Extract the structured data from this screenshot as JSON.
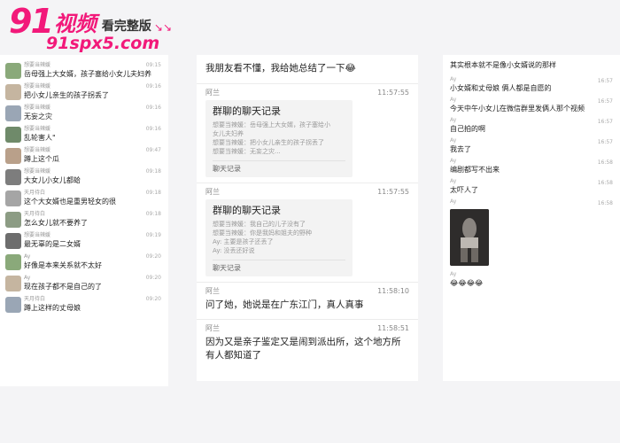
{
  "watermark": {
    "number": "91",
    "brand": "视频",
    "subtitle": "看完整版",
    "arrows": "↘↘",
    "url": "91spx5.com"
  },
  "left_panel": {
    "messages": [
      {
        "name": "想要当辣媛",
        "time": "09:15",
        "text": "岳母强上大女婿，孩子塞给小女儿夫妇养"
      },
      {
        "name": "想要当辣媛",
        "time": "09:16",
        "text": "把小女儿亲生的孩子拐丢了"
      },
      {
        "name": "想要当辣媛",
        "time": "09:16",
        "text": "无妄之灾"
      },
      {
        "name": "想要当辣媛",
        "time": "09:16",
        "text": "乱轮害人\""
      },
      {
        "name": "想要当辣媛",
        "time": "09:47",
        "text": "蹲上这个瓜"
      },
      {
        "name": "想要当辣媛",
        "time": "09:18",
        "text": "大女儿小女儿都蛤"
      },
      {
        "name": "天月待白",
        "time": "09:18",
        "text": "这个大女婿也是重男轻女的很"
      },
      {
        "name": "天月待白",
        "time": "09:18",
        "text": "怎么女儿就不要养了"
      },
      {
        "name": "想要当辣媛",
        "time": "09:19",
        "text": "最无辜的是二女婿"
      },
      {
        "name": "Ay",
        "time": "09:20",
        "text": "好像是本来关系就不太好"
      },
      {
        "name": "Ay",
        "time": "09:20",
        "text": "现在孩子都不是自己的了"
      },
      {
        "name": "天月待白",
        "time": "09:20",
        "text": "蹲上这样的丈母娘"
      }
    ]
  },
  "middle_panel": {
    "top_text": "我朋友看不懂，我给她总结了一下😂",
    "blocks": [
      {
        "sender": "阿兰",
        "time": "11:57:55",
        "card": {
          "title": "群聊的聊天记录",
          "lines": [
            "想要当辣媛：岳母强上大女婿，孩子塞给小",
            "女儿夫妇养",
            "想要当辣媛：把小女儿亲生的孩子拐丢了",
            "想要当辣媛：无妄之灾..."
          ],
          "footer": "聊天记录"
        }
      },
      {
        "sender": "阿兰",
        "time": "11:57:55",
        "card": {
          "title": "群聊的聊天记录",
          "lines": [
            "想要当辣媛：我自己的儿子没有了",
            "想要当辣媛：你是我妈和姐夫的野种",
            "Ay: 主要是孩子还丢了",
            "Ay: 没丢还好说"
          ],
          "footer": "聊天记录"
        }
      },
      {
        "sender": "阿兰",
        "time": "11:58:10",
        "text": "问了她，她说是在广东江门，真人真事"
      },
      {
        "sender": "阿兰",
        "time": "11:58:51",
        "text": "因为又是亲子鉴定又是闹到派出所，这个地方所有人都知道了"
      }
    ]
  },
  "right_panel": {
    "top_text": "其实根本就不是像小女婿说的那样",
    "messages": [
      {
        "name": "Ay",
        "time": "16:57",
        "text": "小女婿和丈母娘 俩人都是自愿的"
      },
      {
        "name": "Ay",
        "time": "16:57",
        "text": "今天中午小女儿在微信群里发俩人那个视频"
      },
      {
        "name": "Ay",
        "time": "16:57",
        "text": "自己拍的啊"
      },
      {
        "name": "Ay",
        "time": "16:57",
        "text": "我去了"
      },
      {
        "name": "Ay",
        "time": "16:58",
        "text": "编剧都写不出来"
      },
      {
        "name": "Ay",
        "time": "16:58",
        "text": "太吓人了"
      },
      {
        "name": "Ay",
        "time": "16:58",
        "text": ""
      },
      {
        "name": "Ay",
        "time": "",
        "text": "😂😂😂😂"
      }
    ]
  },
  "colors": {
    "brand": "#f2197a",
    "page_bg": "#f4f4f6"
  },
  "avatar_colors": [
    "#8aa97a",
    "#c5b5a0",
    "#9aa6b5",
    "#6f8a6a",
    "#b9a08a",
    "#7d7d7d",
    "#a5a5a5",
    "#8c9c84",
    "#6d6d6d"
  ]
}
